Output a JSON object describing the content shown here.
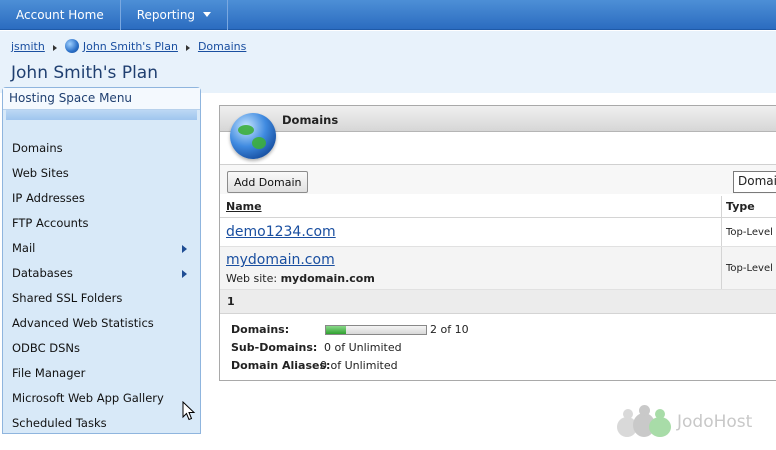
{
  "topnav": {
    "account_home": "Account Home",
    "reporting": "Reporting"
  },
  "breadcrumb": {
    "user": "jsmith",
    "plan": "John Smith's Plan",
    "section": "Domains"
  },
  "page": {
    "title": "John Smith's Plan"
  },
  "sidebar": {
    "title": "Hosting Space Menu",
    "items": [
      {
        "label": "Domains",
        "submenu": false
      },
      {
        "label": "Web Sites",
        "submenu": false
      },
      {
        "label": "IP Addresses",
        "submenu": false
      },
      {
        "label": "FTP Accounts",
        "submenu": false
      },
      {
        "label": "Mail",
        "submenu": true
      },
      {
        "label": "Databases",
        "submenu": true
      },
      {
        "label": "Shared SSL Folders",
        "submenu": false
      },
      {
        "label": "Advanced Web Statistics",
        "submenu": false
      },
      {
        "label": "ODBC DSNs",
        "submenu": false
      },
      {
        "label": "File Manager",
        "submenu": false
      },
      {
        "label": "Microsoft Web App Gallery",
        "submenu": false
      },
      {
        "label": "Scheduled Tasks",
        "submenu": false
      }
    ]
  },
  "panel": {
    "title": "Domains",
    "add_button": "Add Domain",
    "filter_value": "Domain",
    "columns": {
      "name": "Name",
      "type": "Type"
    },
    "rows": [
      {
        "name": "demo1234.com",
        "type": "Top-Level"
      },
      {
        "name": "mydomain.com",
        "type": "Top-Level",
        "website_label": "Web site:",
        "website": "mydomain.com"
      }
    ],
    "page_number": "1",
    "quotas": {
      "domains": {
        "label": "Domains:",
        "value": "2 of 10",
        "fraction": 0.2
      },
      "sub_domains": {
        "label": "Sub-Domains:",
        "value": "0 of Unlimited"
      },
      "domain_aliases": {
        "label": "Domain Aliases:",
        "value": "0 of Unlimited"
      }
    }
  },
  "logo": {
    "text": "JodoHost"
  },
  "colors": {
    "topbar": "#2b6cc0",
    "link": "#1a4fa0",
    "sidebar_bg": "#d8e9f8",
    "quota_fill": "#2fa12f"
  },
  "icons": {
    "globe": "globe-icon",
    "cursor": "mouse-pointer-icon"
  }
}
